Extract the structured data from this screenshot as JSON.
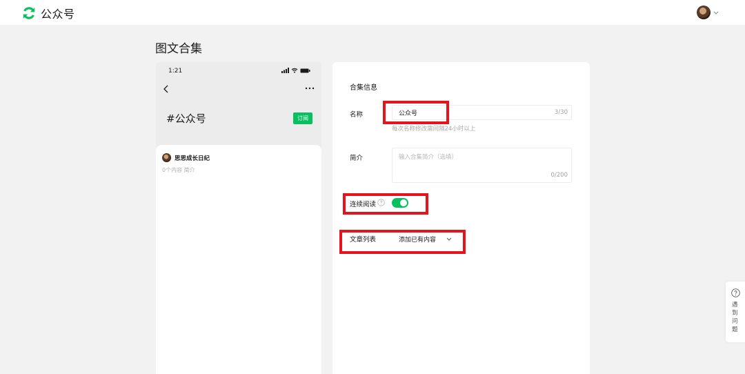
{
  "header": {
    "brand_name": "公众号",
    "brand_icon": "wechat-official-account-logo",
    "colors": {
      "brand": "#07c160"
    }
  },
  "page": {
    "title": "图文合集"
  },
  "preview": {
    "status_time": "1:21",
    "hashtag_title": "#公众号",
    "subscribe_label": "订阅",
    "author_name": "思思成长日纪",
    "author_meta": "0个内容  简介"
  },
  "form": {
    "section_title": "合集信息",
    "name": {
      "label": "名称",
      "value": "公众号",
      "count": "3/30",
      "tip": "每次名称修改需间隔24小时以上"
    },
    "description": {
      "label": "简介",
      "placeholder": "输入合集简介（选填）",
      "count": "0/200"
    },
    "continuous_reading": {
      "label": "连续阅读",
      "enabled": true
    },
    "article_list": {
      "label": "文章列表",
      "selected": "添加已有内容"
    }
  },
  "help_widget": {
    "label": "遇到问题"
  }
}
